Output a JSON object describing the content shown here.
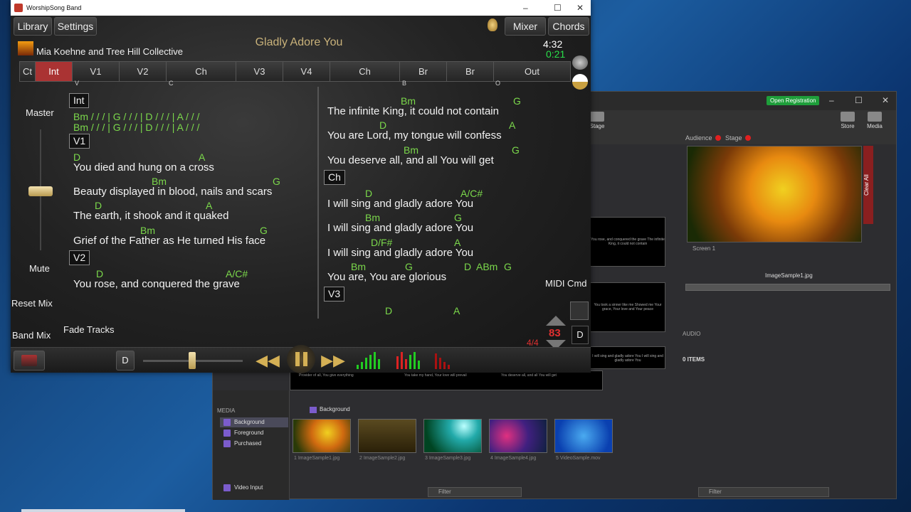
{
  "front": {
    "window_title": "WorshipSong Band",
    "menu": {
      "library": "Library",
      "settings": "Settings",
      "mixer": "Mixer",
      "chords": "Chords"
    },
    "song_title": "Gladly Adore You",
    "artist": "Mia Koehne and Tree Hill Collective",
    "duration": "4:32",
    "elapsed": "0:21",
    "sections": [
      "Ct",
      "Int",
      "V1",
      "V2",
      "Ch",
      "V3",
      "V4",
      "Ch",
      "Br",
      "Br",
      "Out"
    ],
    "active_section": "Int",
    "chord_markers": [
      "V",
      "C",
      "B",
      "O"
    ],
    "side": {
      "master": "Master",
      "mute": "Mute",
      "reset_mix": "Reset Mix",
      "band_mix": "Band Mix",
      "fade_tracks": "Fade Tracks",
      "midi_cmd": "MIDI Cmd"
    },
    "key": "D",
    "tempo": "83",
    "time_sig": "4/4",
    "key2": "D",
    "lyrics_left": {
      "int_label": "Int",
      "int_line1": "Bm / / / | G / / / | D / / / | A / / /",
      "int_line2": "Bm / / / | G / / / | D / / / | A / / /",
      "v1_label": "V1",
      "l1_chords": [
        "D",
        "A"
      ],
      "l1": "You died and hung on a cross",
      "l2_chords": [
        "Bm",
        "G"
      ],
      "l2": "Beauty displayed in blood, nails and scars",
      "l3_chords": [
        "D",
        "A"
      ],
      "l3": "The earth, it shook and it quaked",
      "l4_chords": [
        "Bm",
        "G"
      ],
      "l4": "Grief of the Father as He turned His face",
      "v2_label": "V2",
      "l5_chords": [
        "D",
        "A/C#"
      ],
      "l5": "You rose, and conquered the grave"
    },
    "lyrics_right": {
      "r1_chords": [
        "Bm",
        "G"
      ],
      "r1": "The infinite King, it could not contain",
      "r2_chords": [
        "D",
        "A"
      ],
      "r2": "You are Lord, my tongue will confess",
      "r3_chords": [
        "Bm",
        "G"
      ],
      "r3": "You deserve all, and all You will get",
      "ch_label": "Ch",
      "r4_chords": [
        "D",
        "A/C#"
      ],
      "r4": "I will sing and gladly adore You",
      "r5_chords": [
        "Bm",
        "G"
      ],
      "r5": "I will sing and gladly adore You",
      "r6_chords": [
        "D/F#",
        "A"
      ],
      "r6": "I will sing and gladly adore You",
      "r7_chords": [
        "Bm",
        "G",
        "D",
        "ABm",
        "G"
      ],
      "r7": "You are, You are glorious",
      "v3_label": "V3",
      "r8_chords": [
        "D",
        "A"
      ]
    }
  },
  "back": {
    "open_registration": "Open Registration",
    "stage_tab": "Stage",
    "store": "Store",
    "media_tab": "Media",
    "audience": "Audience",
    "stage": "Stage",
    "clear_all": "Clear All",
    "screen": "Screen 1",
    "image_name": "ImageSample1.jpg",
    "audio": "AUDIO",
    "items": "0 ITEMS",
    "filter": "Filter",
    "media_header": "MEDIA",
    "media_items": [
      "Background",
      "Foreground",
      "Purchased"
    ],
    "selected_media": "Background",
    "background_header": "Background",
    "thumbs": [
      {
        "n": "1",
        "name": "ImageSample1.jpg"
      },
      {
        "n": "2",
        "name": "ImageSample2.jpg"
      },
      {
        "n": "3",
        "name": "ImageSample3.jpg"
      },
      {
        "n": "4",
        "name": "ImageSample4.jpg"
      },
      {
        "n": "5",
        "name": "VideoSample.mov"
      }
    ],
    "slides": [
      "You rose, and conquered the grave The infinite King, it could not contain",
      "You took a sinner like me Showed me Your grace, Your love and Your peace",
      "I will sing and gladly adore You I will sing and gladly adore You"
    ],
    "strip": [
      "Provider of all, You give everything",
      "You take my hand, Your love will prevail",
      "You deserve all, and all You will get"
    ],
    "video_input": "Video Input"
  }
}
